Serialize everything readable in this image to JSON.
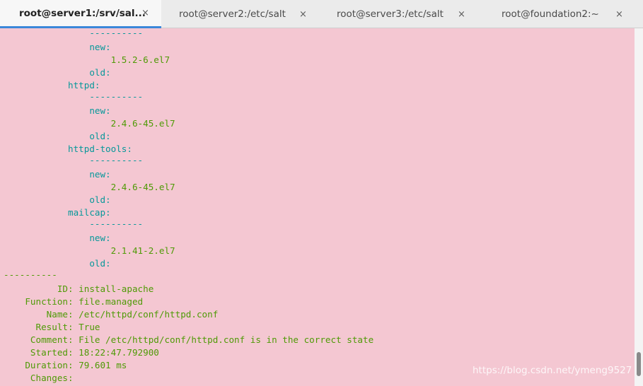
{
  "tabs": [
    {
      "label": "root@server1:/srv/sal...",
      "close": "×",
      "active": true
    },
    {
      "label": "root@server2:/etc/salt",
      "close": "×",
      "active": false
    },
    {
      "label": "root@server3:/etc/salt",
      "close": "×",
      "active": false
    },
    {
      "label": "root@foundation2:~",
      "close": "×",
      "active": false
    }
  ],
  "terminal": {
    "lines": [
      {
        "text": "                ----------",
        "color": "cyan"
      },
      {
        "text": "                new:",
        "color": "cyan"
      },
      {
        "text": "                    1.5.2-6.el7",
        "color": "green"
      },
      {
        "text": "                old:",
        "color": "cyan"
      },
      {
        "text": "            httpd:",
        "color": "cyan"
      },
      {
        "text": "                ----------",
        "color": "cyan"
      },
      {
        "text": "                new:",
        "color": "cyan"
      },
      {
        "text": "                    2.4.6-45.el7",
        "color": "green"
      },
      {
        "text": "                old:",
        "color": "cyan"
      },
      {
        "text": "            httpd-tools:",
        "color": "cyan"
      },
      {
        "text": "                ----------",
        "color": "cyan"
      },
      {
        "text": "                new:",
        "color": "cyan"
      },
      {
        "text": "                    2.4.6-45.el7",
        "color": "green"
      },
      {
        "text": "                old:",
        "color": "cyan"
      },
      {
        "text": "            mailcap:",
        "color": "cyan"
      },
      {
        "text": "                ----------",
        "color": "cyan"
      },
      {
        "text": "                new:",
        "color": "cyan"
      },
      {
        "text": "                    2.1.41-2.el7",
        "color": "green"
      },
      {
        "text": "                old:",
        "color": "cyan"
      },
      {
        "text": "----------",
        "color": "green"
      },
      {
        "text": "          ID: install-apache",
        "color": "green"
      },
      {
        "text": "    Function: file.managed",
        "color": "green"
      },
      {
        "text": "        Name: /etc/httpd/conf/httpd.conf",
        "color": "green"
      },
      {
        "text": "      Result: True",
        "color": "green"
      },
      {
        "text": "     Comment: File /etc/httpd/conf/httpd.conf is in the correct state",
        "color": "green"
      },
      {
        "text": "     Started: 18:22:47.792900",
        "color": "green"
      },
      {
        "text": "    Duration: 79.601 ms",
        "color": "green"
      },
      {
        "text": "     Changes:",
        "color": "green"
      }
    ]
  },
  "watermark": "https://blog.csdn.net/ymeng9527",
  "colors": {
    "green": "#4e9a06",
    "cyan": "#06989a",
    "background": "#f4c7d2",
    "accent": "#3b87d9"
  }
}
